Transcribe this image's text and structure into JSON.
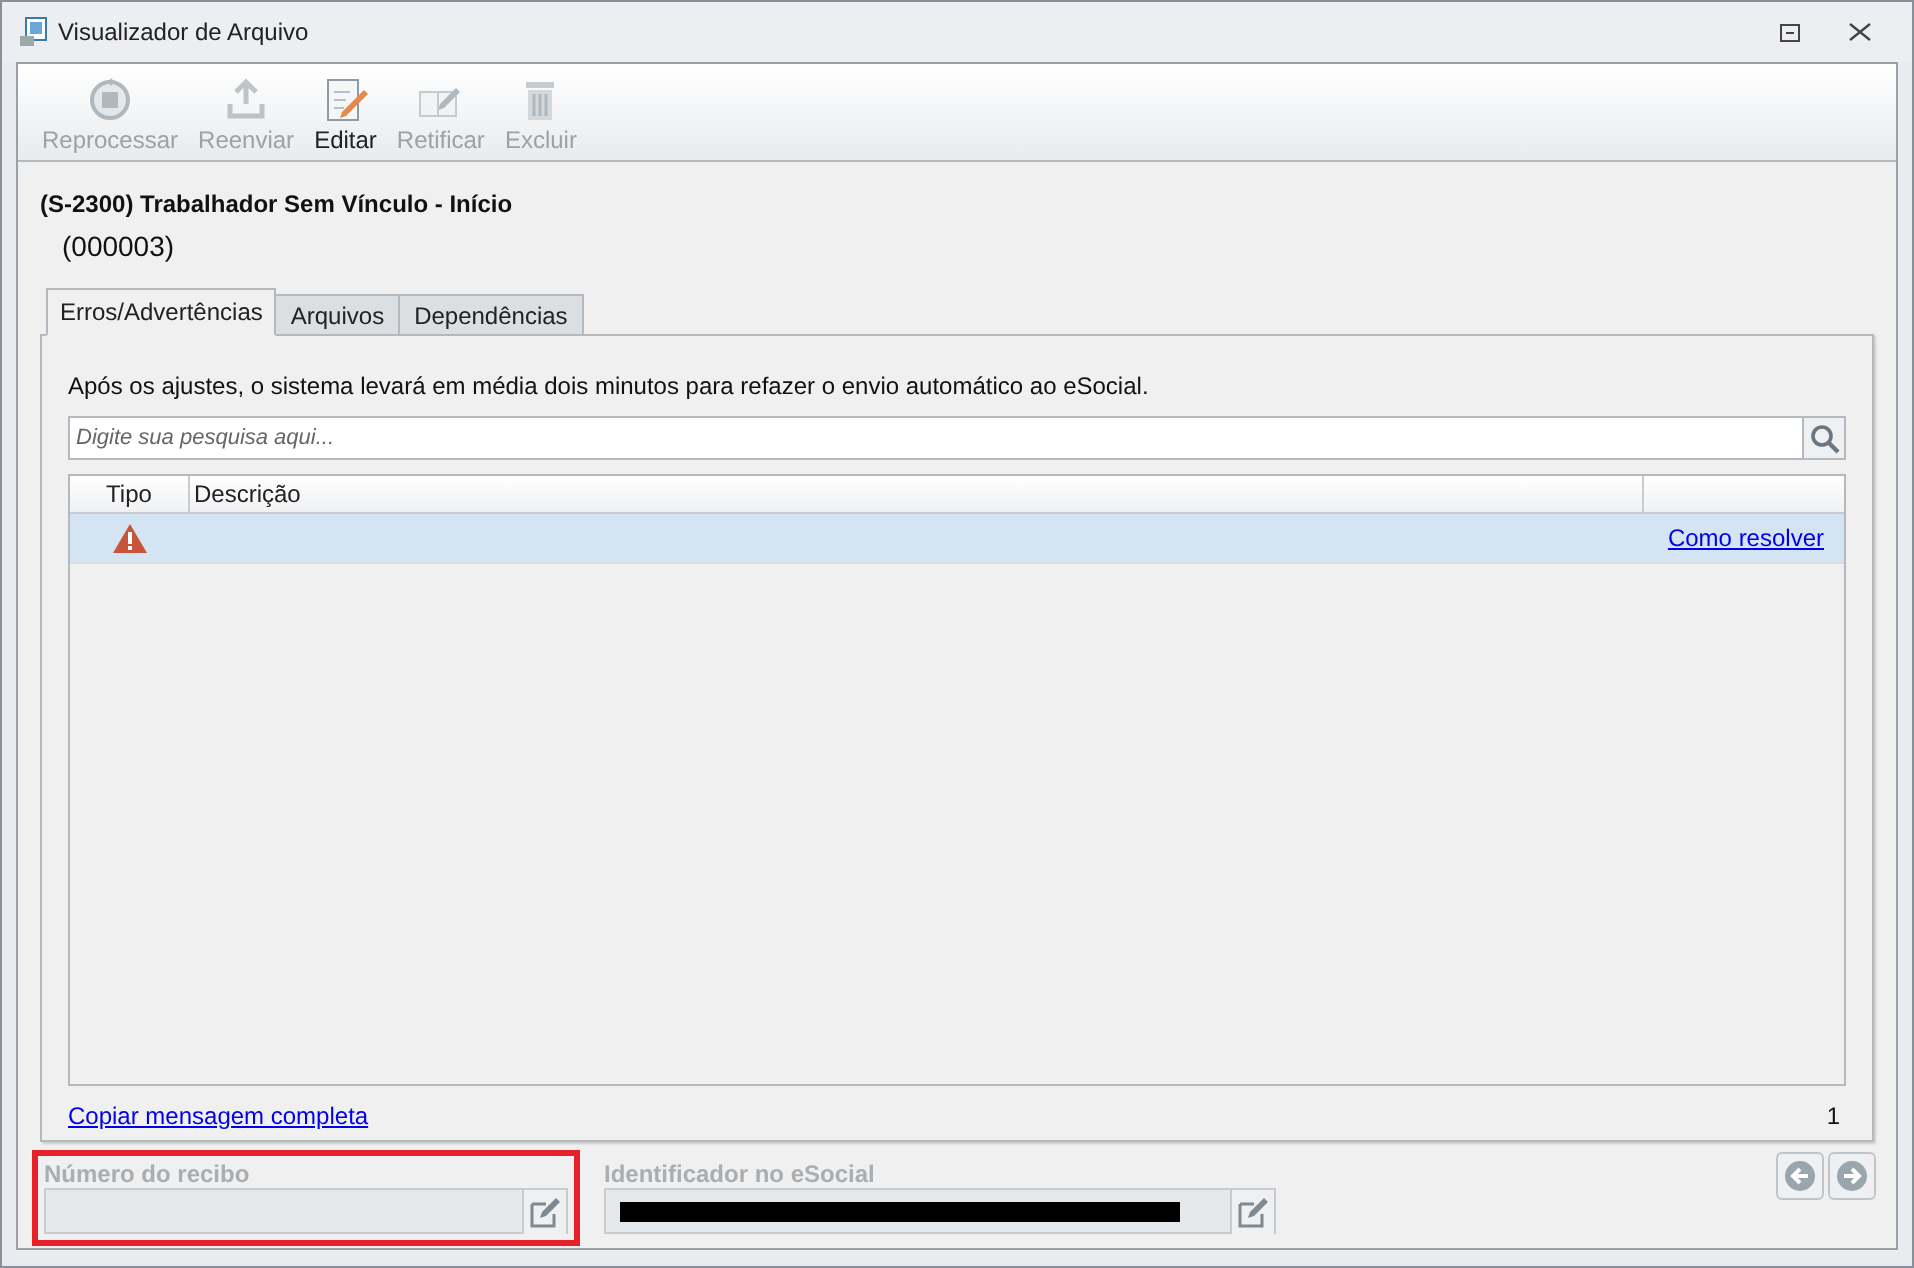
{
  "window": {
    "title": "Visualizador de Arquivo"
  },
  "toolbar": [
    {
      "label": "Reprocessar",
      "kind": "reprocess",
      "disabled": true
    },
    {
      "label": "Reenviar",
      "kind": "upload",
      "disabled": true
    },
    {
      "label": "Editar",
      "kind": "edit",
      "disabled": false
    },
    {
      "label": "Retificar",
      "kind": "rectify",
      "disabled": true
    },
    {
      "label": "Excluir",
      "kind": "delete",
      "disabled": true
    }
  ],
  "event": {
    "title": "(S-2300) Trabalhador Sem Vínculo - Início",
    "code": "(000003)"
  },
  "tabs": [
    {
      "label": "Erros/Advertências",
      "selected": true
    },
    {
      "label": "Arquivos",
      "selected": false
    },
    {
      "label": "Dependências",
      "selected": false
    }
  ],
  "notice": "Após os ajustes, o sistema levará em média dois minutos para refazer o envio automático ao eSocial.",
  "search": {
    "placeholder": "Digite sua pesquisa aqui..."
  },
  "table": {
    "columns": [
      "Tipo",
      "Descrição"
    ],
    "rows": [
      {
        "kind": "warning",
        "link": "Como resolver",
        "selected": true
      }
    ]
  },
  "copy_link": "Copiar mensagem completa",
  "count": "1",
  "fields": [
    {
      "label": "Número do recibo",
      "redacted": false,
      "highlighted": true
    },
    {
      "label": "Identificador no eSocial",
      "redacted": true,
      "highlighted": false
    }
  ]
}
